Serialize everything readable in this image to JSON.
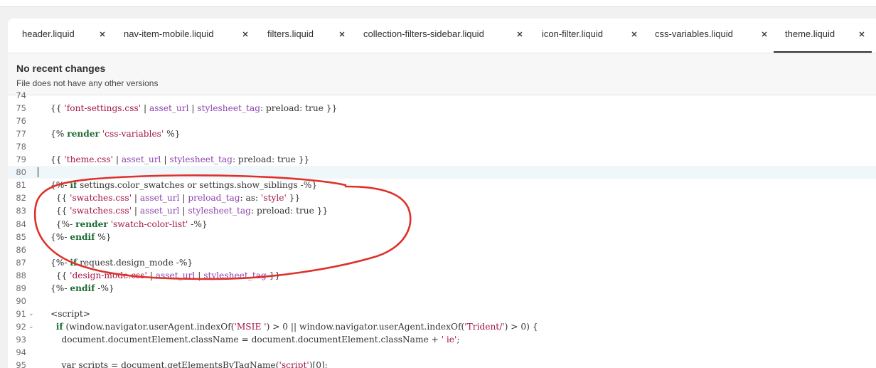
{
  "tabs": [
    {
      "label": "header.liquid",
      "active": false
    },
    {
      "label": "nav-item-mobile.liquid",
      "active": false
    },
    {
      "label": "filters.liquid",
      "active": false
    },
    {
      "label": "collection-filters-sidebar.liquid",
      "active": false
    },
    {
      "label": "icon-filter.liquid",
      "active": false
    },
    {
      "label": "css-variables.liquid",
      "active": false
    },
    {
      "label": "theme.liquid",
      "active": true
    }
  ],
  "info": {
    "title": "No recent changes",
    "subtitle": "File does not have any other versions"
  },
  "editor": {
    "current_line": 80,
    "lines": [
      {
        "num": "74",
        "text": ""
      },
      {
        "num": "75",
        "text": "{{ 'font-settings.css' | asset_url | stylesheet_tag: preload: true }}"
      },
      {
        "num": "76",
        "text": ""
      },
      {
        "num": "77",
        "text": "{% render 'css-variables' %}"
      },
      {
        "num": "78",
        "text": ""
      },
      {
        "num": "79",
        "text": "{{ 'theme.css' | asset_url | stylesheet_tag: preload: true }}"
      },
      {
        "num": "80",
        "text": ""
      },
      {
        "num": "81",
        "text": "{%- if settings.color_swatches or settings.show_siblings -%}"
      },
      {
        "num": "82",
        "text": "  {{ 'swatches.css' | asset_url | preload_tag: as: 'style' }}"
      },
      {
        "num": "83",
        "text": "  {{ 'swatches.css' | asset_url | stylesheet_tag: preload: true }}"
      },
      {
        "num": "84",
        "text": "  {%- render 'swatch-color-list' -%}"
      },
      {
        "num": "85",
        "text": "{%- endif %}"
      },
      {
        "num": "86",
        "text": ""
      },
      {
        "num": "87",
        "text": "{%- if request.design_mode -%}"
      },
      {
        "num": "88",
        "text": "  {{ 'design-mode.css' | asset_url | stylesheet_tag }}"
      },
      {
        "num": "89",
        "text": "{%- endif -%}"
      },
      {
        "num": "90",
        "text": ""
      },
      {
        "num": "91",
        "text": "<script>",
        "fold": true
      },
      {
        "num": "92",
        "text": "  if (window.navigator.userAgent.indexOf('MSIE ') > 0 || window.navigator.userAgent.indexOf('Trident/') > 0) {",
        "fold": true
      },
      {
        "num": "93",
        "text": "    document.documentElement.className = document.documentElement.className + ' ie';"
      },
      {
        "num": "94",
        "text": ""
      },
      {
        "num": "95",
        "text": "    var scripts = document.getElementsByTagName('script')[0];"
      }
    ]
  },
  "colors": {
    "annotation": "#e0302a",
    "string": "#a31545",
    "keyword": "#1d6b34",
    "filter": "#8e44ad"
  },
  "icons": {
    "tab_close": "close-icon",
    "fold": "chevron-down-icon"
  }
}
